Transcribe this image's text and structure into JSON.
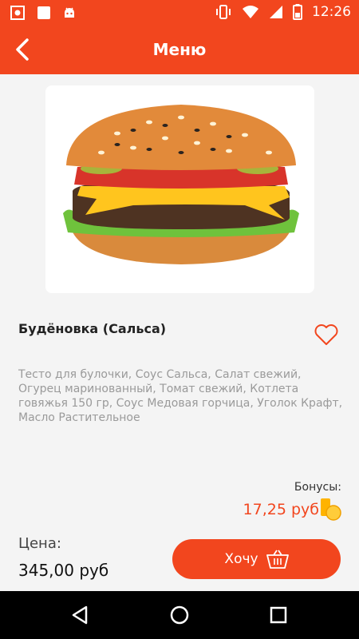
{
  "status_bar": {
    "time": "12:26",
    "left_icons": [
      "screenshot-icon",
      "message-icon",
      "android-icon"
    ],
    "right_icons": [
      "vibrate-icon",
      "wifi-icon",
      "signal-icon",
      "battery-icon"
    ]
  },
  "app_bar": {
    "title": "Меню",
    "back_icon": "chevron-left-icon"
  },
  "product": {
    "image": "burger-image",
    "name": "Будёновка (Сальса)",
    "description": "Тесто для булочки, Соус Сальса, Салат свежий, Огурец маринованный, Томат свежий, Котлета говяжья 150 гр, Соус Медовая горчица, Уголок Крафт, Масло Растительное",
    "favorite_icon": "heart-icon"
  },
  "bonus": {
    "label": "Бонусы:",
    "value": "17,25 руб",
    "icon": "coins-icon"
  },
  "price": {
    "label": "Цена:",
    "value": "345,00 руб"
  },
  "want_button": {
    "label": "Хочу",
    "icon": "basket-icon"
  },
  "nav_bar": {
    "buttons": [
      "back-triangle-icon",
      "home-circle-icon",
      "recents-square-icon"
    ]
  },
  "colors": {
    "accent": "#f2461e",
    "background": "#f4f4f4",
    "description_text": "#9a9a9a"
  }
}
